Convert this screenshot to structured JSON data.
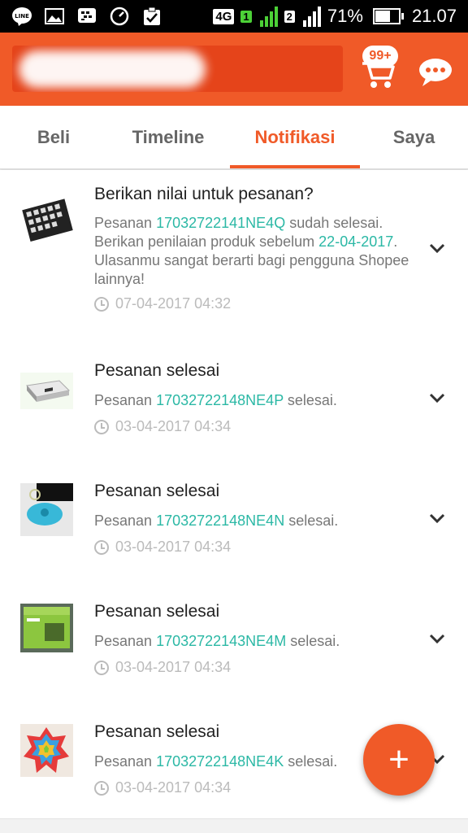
{
  "status_bar": {
    "network": "4G",
    "sim1": "1",
    "sim2": "2",
    "battery_text": "71%",
    "battery_level": 0.71,
    "time": "21.07",
    "left_icons": [
      "line-icon",
      "gallery-icon",
      "bbm-icon",
      "speedometer-icon",
      "clipboard-check-icon"
    ],
    "line_label": "LINE"
  },
  "header": {
    "cart_badge": "99+",
    "cart_icon": "cart-icon",
    "chat_icon": "chat-icon"
  },
  "tabs": [
    {
      "label": "Beli",
      "active": false
    },
    {
      "label": "Timeline",
      "active": false
    },
    {
      "label": "Notifikasi",
      "active": true
    },
    {
      "label": "Saya",
      "active": false
    }
  ],
  "notifications": [
    {
      "title": "Berikan nilai untuk pesanan?",
      "prefix": "Pesanan ",
      "order": "17032722141NE4Q",
      "suffix1": " sudah selesai. Berikan penilaian produk sebelum ",
      "due_date": "22-04-2017",
      "suffix2": ". Ulasanmu sangat berarti bagi pengguna Shopee lainnya!",
      "timestamp": "07-04-2017 04:32"
    },
    {
      "title": "Pesanan selesai",
      "prefix": "Pesanan ",
      "order": "17032722148NE4P",
      "suffix1": " selesai.",
      "timestamp": "03-04-2017 04:34"
    },
    {
      "title": "Pesanan selesai",
      "prefix": "Pesanan ",
      "order": "17032722148NE4N",
      "suffix1": " selesai.",
      "timestamp": "03-04-2017 04:34"
    },
    {
      "title": "Pesanan selesai",
      "prefix": "Pesanan ",
      "order": "17032722143NE4M",
      "suffix1": " selesai.",
      "timestamp": "03-04-2017 04:34"
    },
    {
      "title": "Pesanan selesai",
      "prefix": "Pesanan ",
      "order": "17032722148NE4K",
      "suffix1": " selesai.",
      "timestamp": "03-04-2017 04:34"
    }
  ],
  "fab": {
    "label": "+"
  },
  "colors": {
    "brand": "#f05a28",
    "link": "#2bb8a5",
    "timestamp": "#bbbbbb"
  }
}
